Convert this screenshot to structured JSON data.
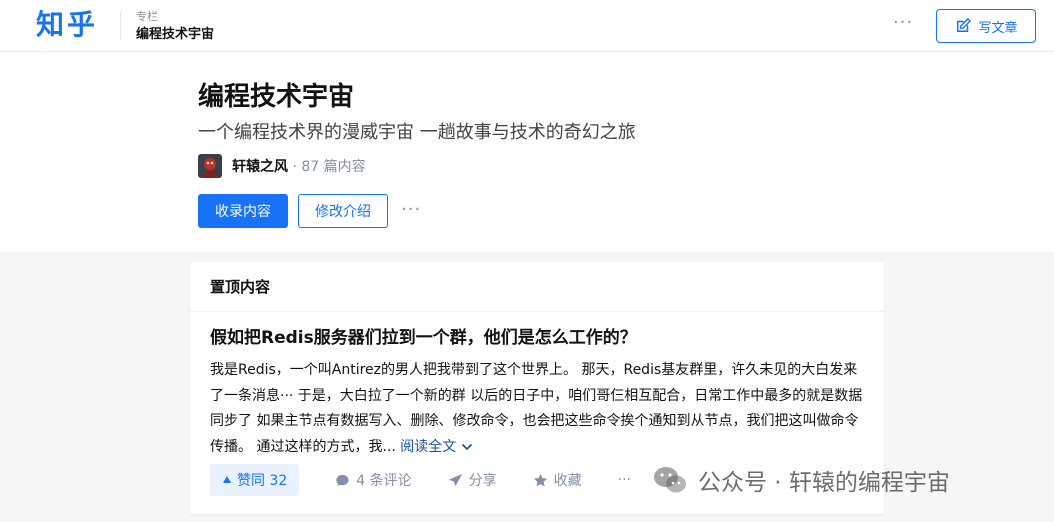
{
  "header": {
    "logo": "知乎",
    "crumb_label": "专栏",
    "crumb_title": "编程技术宇宙",
    "more": "···",
    "write_label": "写文章"
  },
  "column": {
    "title": "编程技术宇宙",
    "description": "一个编程技术界的漫威宇宙 一趟故事与技术的奇幻之旅",
    "author": "轩辕之风",
    "meta": " · 87 篇内容",
    "collect_label": "收录内容",
    "edit_label": "修改介绍",
    "more": "···"
  },
  "pinned": {
    "section_title": "置顶内容",
    "article_title": "假如把Redis服务器们拉到一个群，他们是怎么工作的？",
    "excerpt": "我是Redis，一个叫Antirez的男人把我带到了这个世界上。 那天，Redis基友群里，许久未见的大白发来了一条消息··· 于是，大白拉了一个新的群 以后的日子中，咱们哥仨相互配合，日常工作中最多的就是数据同步了 如果主节点有数据写入、删除、修改命令，也会把这些命令挨个通知到从节点，我们把这叫做命令传播。 通过这样的方式，我...",
    "read_more": "阅读全文",
    "vote_label": "赞同 32",
    "comment_label": "4 条评论",
    "share_label": "分享",
    "favorite_label": "收藏",
    "more": "···"
  },
  "watermark": {
    "text": "公众号 · 轩辕的编程宇宙"
  },
  "colors": {
    "brand": "#1772f6",
    "vote_bg": "#ebf2ff",
    "muted": "#8590a6"
  },
  "icons": [
    "edit-icon",
    "more-icon",
    "upvote-icon",
    "comment-icon",
    "share-icon",
    "star-icon",
    "chevron-down-icon",
    "wechat-icon"
  ]
}
